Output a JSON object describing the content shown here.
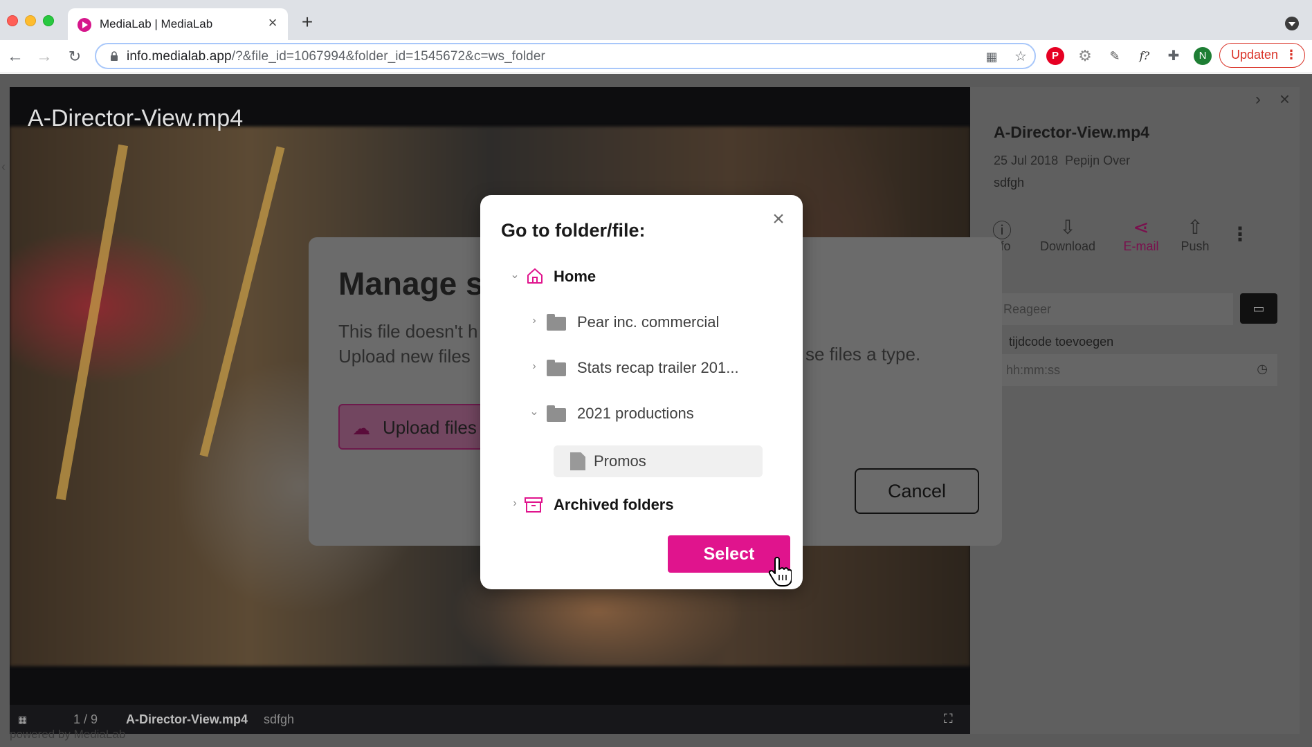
{
  "browser": {
    "tab_title": "MediaLab | MediaLab",
    "url_host": "info.medialab.app",
    "url_rest": "/?&file_id=1067994&folder_id=1545672&c=ws_folder",
    "profile_initial": "N",
    "update_label": "Updaten",
    "extension_text": "f?"
  },
  "viewer": {
    "title": "A-Director-View.mp4",
    "counter": "1 / 9",
    "filename": "A-Director-View.mp4",
    "description": "sdfgh",
    "powered_by": "powered by MediaLab"
  },
  "side_panel": {
    "title": "A-Director-View.mp4",
    "date": "25 Jul 2018",
    "author": "Pepijn Over",
    "description": "sdfgh",
    "actions": [
      {
        "label": "nfo",
        "icon": "info-icon"
      },
      {
        "label": "Download",
        "icon": "download-icon"
      },
      {
        "label": "E-mail",
        "icon": "share-icon"
      },
      {
        "label": "Push",
        "icon": "upload-icon"
      }
    ],
    "comment_placeholder": "Reageer",
    "timecode_label": "tijdcode toevoegen",
    "timecode_placeholder": "hh:mm:ss"
  },
  "manage_dialog": {
    "title": "Manage s",
    "text_line1": "This file doesn't h",
    "text_line2": "Upload new files",
    "text_tail": "se files a type.",
    "upload_label": "Upload files",
    "cancel_label": "Cancel"
  },
  "goto_modal": {
    "title": "Go to folder/file:",
    "home_label": "Home",
    "items": [
      {
        "label": "Pear inc. commercial",
        "type": "folder",
        "expanded": false
      },
      {
        "label": "Stats recap trailer 201...",
        "type": "folder",
        "expanded": false
      },
      {
        "label": "2021 productions",
        "type": "folder",
        "expanded": true
      },
      {
        "label": "Promos",
        "type": "file",
        "selected": true
      }
    ],
    "archived_label": "Archived folders",
    "select_label": "Select"
  },
  "colors": {
    "accent": "#e0148d",
    "update_red": "#d93025"
  }
}
